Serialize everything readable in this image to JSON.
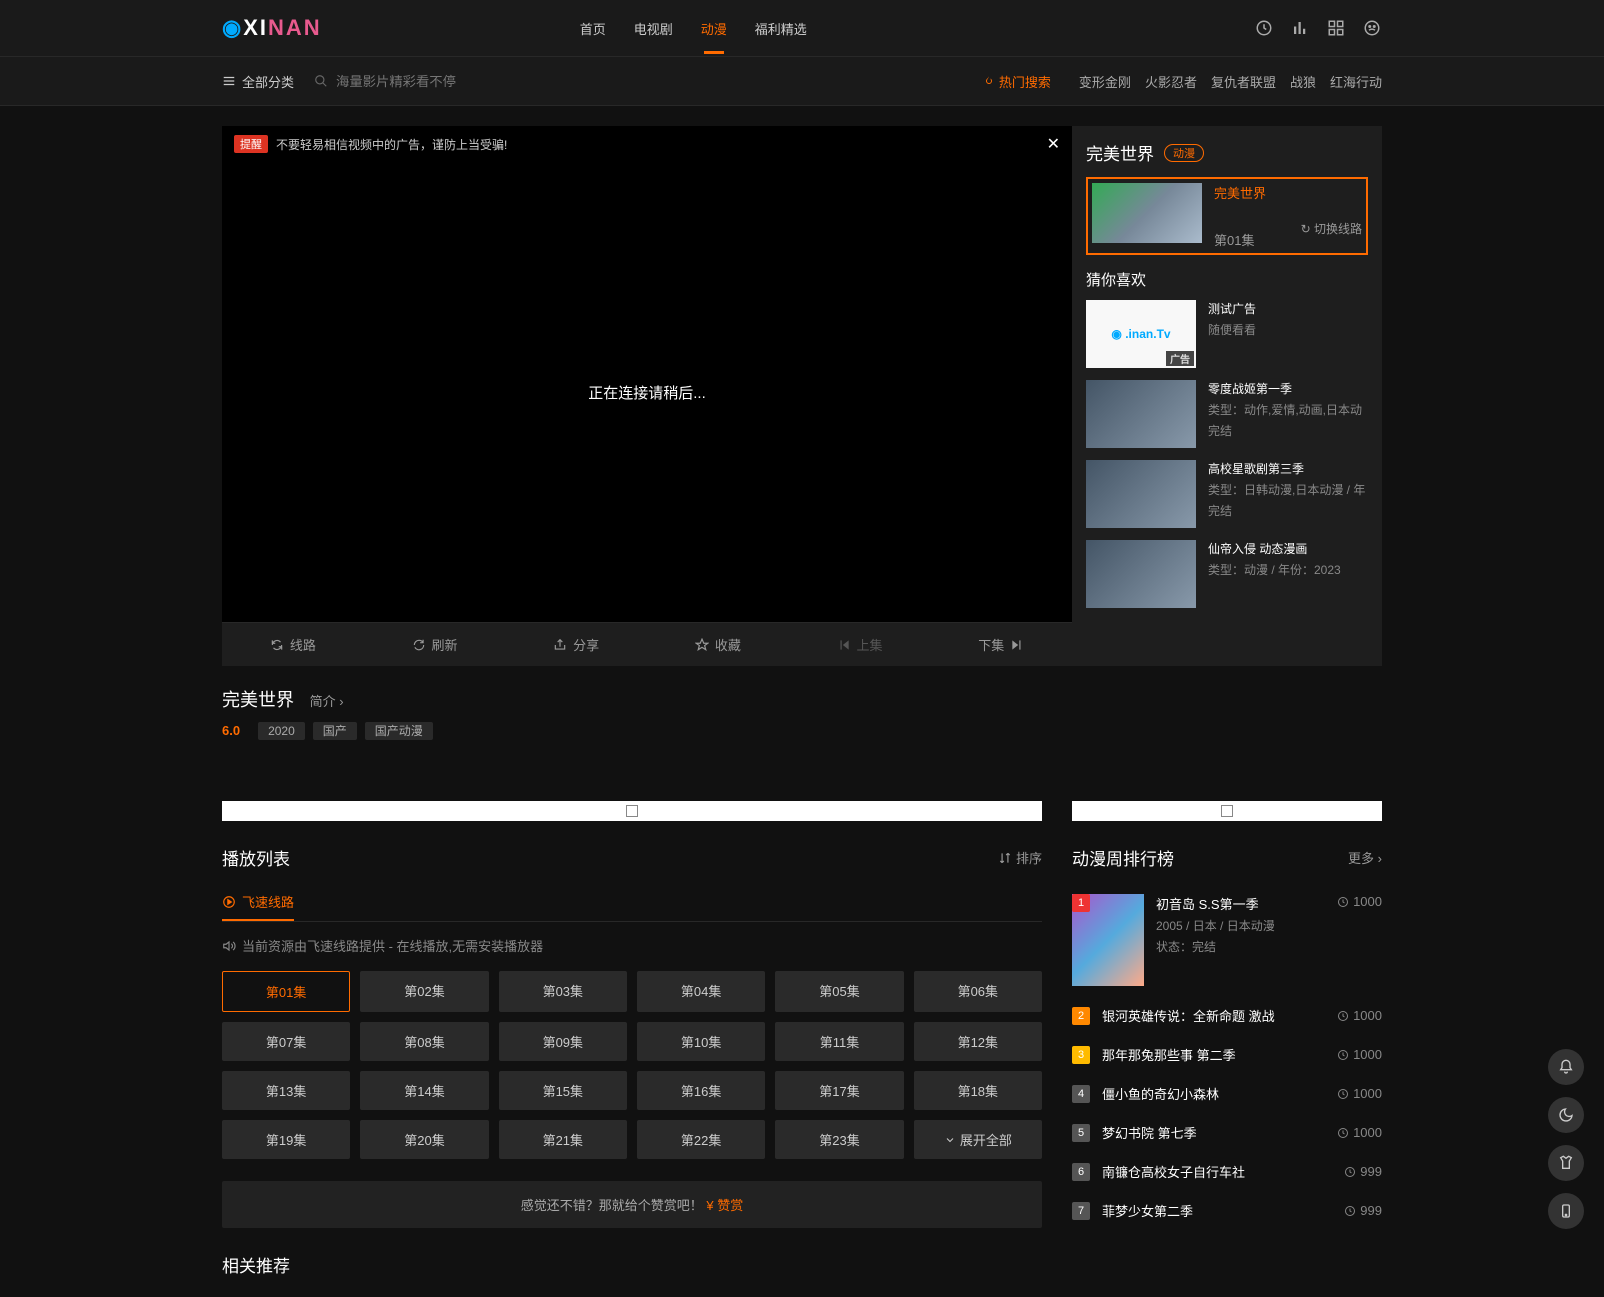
{
  "header": {
    "nav": [
      "首页",
      "电视剧",
      "动漫",
      "福利精选"
    ],
    "active_index": 2
  },
  "subheader": {
    "allcat": "全部分类",
    "search_placeholder": "海量影片精彩看不停",
    "hot_label": "热门搜索",
    "hot_tags": [
      "变形金刚",
      "火影忍者",
      "复仇者联盟",
      "战狼",
      "红海行动"
    ]
  },
  "player": {
    "tip_badge": "提醒",
    "tip_text": "不要轻易相信视频中的广告，谨防上当受骗!",
    "loading": "正在连接请稍后...",
    "bar": {
      "route": "线路",
      "refresh": "刷新",
      "share": "分享",
      "fav": "收藏",
      "prev": "上集",
      "next": "下集"
    }
  },
  "side": {
    "title": "完美世界",
    "badge": "动漫",
    "featured": {
      "name": "完美世界",
      "ep": "第01集",
      "switch": "切换线路"
    },
    "rec_title": "猜你喜欢",
    "recs": [
      {
        "name": "测试广告",
        "meta": "随便看看",
        "ad": true,
        "ad_tag": "广告"
      },
      {
        "name": "零度战姬第一季",
        "meta": "类型：动作,爱情,动画,日本动",
        "meta2": "完结"
      },
      {
        "name": "高校星歌剧第三季",
        "meta": "类型：日韩动漫,日本动漫 / 年",
        "meta2": "完结"
      },
      {
        "name": "仙帝入侵 动态漫画",
        "meta": "类型：动漫 / 年份：2023"
      }
    ]
  },
  "meta": {
    "title": "完美世界",
    "brief": "简介",
    "score": "6.0",
    "chips": [
      "2020",
      "国产",
      "国产动漫"
    ]
  },
  "playlist": {
    "title": "播放列表",
    "sort": "排序",
    "tab": "飞速线路",
    "source_tip": "当前资源由飞速线路提供 - 在线播放,无需安装播放器",
    "episodes": [
      "第01集",
      "第02集",
      "第03集",
      "第04集",
      "第05集",
      "第06集",
      "第07集",
      "第08集",
      "第09集",
      "第10集",
      "第11集",
      "第12集",
      "第13集",
      "第14集",
      "第15集",
      "第16集",
      "第17集",
      "第18集",
      "第19集",
      "第20集",
      "第21集",
      "第22集",
      "第23集"
    ],
    "expand": "展开全部",
    "praise_pre": "感觉还不错？那就给个赞赏吧！",
    "praise_act": "赞赏"
  },
  "ranking": {
    "title": "动漫周排行榜",
    "more": "更多",
    "items": [
      {
        "n": "1",
        "name": "初音岛 S.S第一季",
        "meta": "2005 / 日本 / 日本动漫",
        "status": "状态：完结",
        "count": "1000"
      },
      {
        "n": "2",
        "name": "银河英雄传说：全新命题 激战",
        "count": "1000"
      },
      {
        "n": "3",
        "name": "那年那兔那些事 第二季",
        "count": "1000"
      },
      {
        "n": "4",
        "name": "僵小鱼的奇幻小森林",
        "count": "1000"
      },
      {
        "n": "5",
        "name": "梦幻书院 第七季",
        "count": "1000"
      },
      {
        "n": "6",
        "name": "南镰仓高校女子自行车社",
        "count": "999"
      },
      {
        "n": "7",
        "name": "菲梦少女第二季",
        "count": "999"
      }
    ]
  },
  "related": {
    "title": "相关推荐"
  }
}
